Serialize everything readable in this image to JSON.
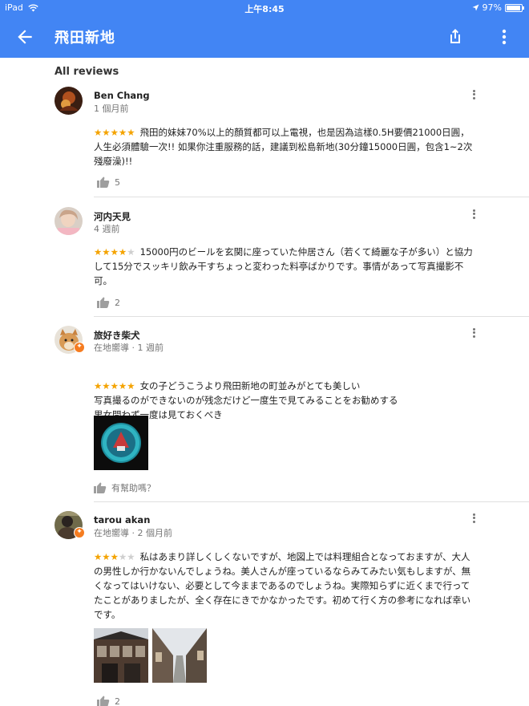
{
  "status": {
    "device": "iPad",
    "time": "上午8:45",
    "battery": "97%",
    "battery_level": 0.97
  },
  "header": {
    "title": "飛田新地"
  },
  "section_title": "All reviews",
  "reviews": [
    {
      "author": "Ben Chang",
      "meta": "1 個月前",
      "rating": 5,
      "stars_on": "★★★★★",
      "stars_off": "",
      "text": "飛田的妹妹70%以上的顏質都可以上電視，也是因為這樣0.5H要價21000日圓，人生必須體驗一次!! 如果你注重服務的話，建議到松島新地(30分鐘15000日圓，包含1~2次殘廢澡)!!",
      "likes": "5"
    },
    {
      "author": "河内天見",
      "meta": "4 週前",
      "rating": 4,
      "stars_on": "★★★★",
      "stars_off": "★",
      "text": "15000円のビールを玄関に座っていた仲居さん（若くて綺麗な子が多い）と協力して15分でスッキリ飲み干すちょっと変わった料亭ばかりです。事情があって写真撮影不可。",
      "likes": "2"
    },
    {
      "author": "旅好き柴犬",
      "meta": "在地嚮導 · 1 週前",
      "rating": 5,
      "stars_on": "★★★★★",
      "stars_off": "",
      "text": "女の子どうこうより飛田新地の町並みがとても美しい\n写真撮るのができないのが残念だけど一度生で見てみることをお勧めする\n男女問わず一度は見ておくべき",
      "likes": "有幫助嗎？"
    },
    {
      "author": "tarou akan",
      "meta": "在地嚮導 · 2 個月前",
      "rating": 3,
      "stars_on": "★★★",
      "stars_off": "★★",
      "text": "私はあまり詳しくしくないですが、地図上では料理組合となっておますが、大人の男性しか行かないんでしょうね。美人さんが座っているならみてみたい気もしますが、無くなってはいけない、必要として今ままであるのでしょうね。実際知らずに近くまで行ってたことがありましたが、全く存在にきでかなかったです。初めて行く方の参考になれば幸いです。",
      "likes": "2"
    }
  ],
  "colors": {
    "app_bar": "#4285f4",
    "star": "#f4a300",
    "local_guide": "#f57c20"
  },
  "icons": [
    "back-arrow-icon",
    "share-icon",
    "more-vert-icon",
    "thumb-up-icon",
    "wifi-icon",
    "location-arrow-icon",
    "battery-icon"
  ]
}
